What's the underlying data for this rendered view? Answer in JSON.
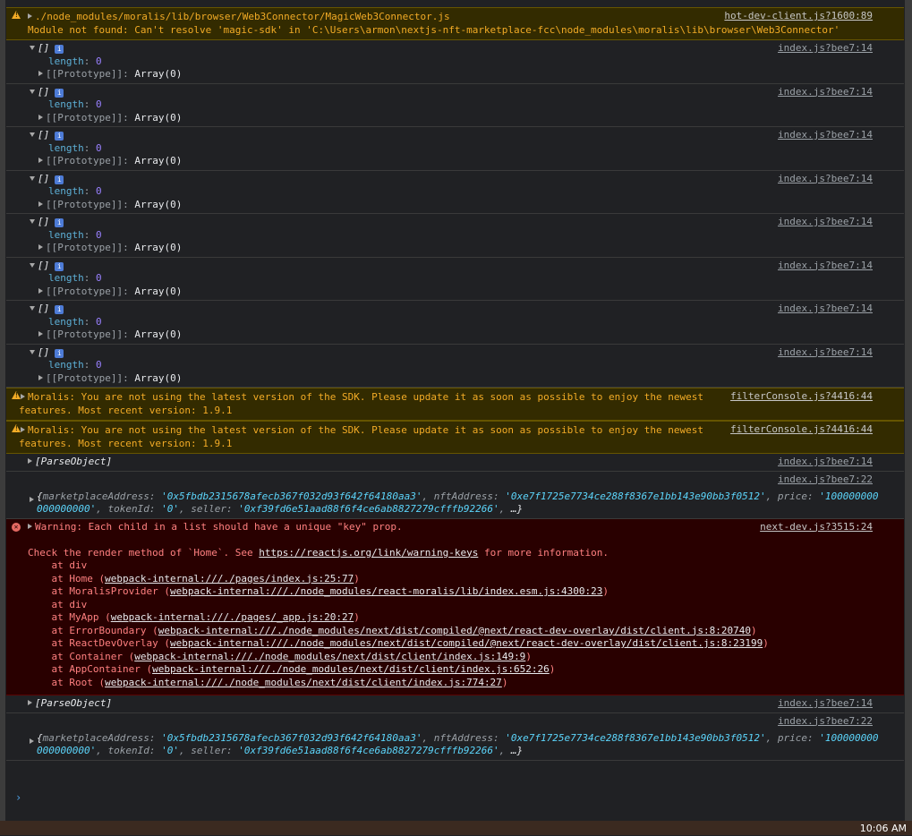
{
  "warning1": {
    "path": "./node_modules/moralis/lib/browser/Web3Connector/MagicWeb3Connector.js",
    "message": "Module not found: Can't resolve 'magic-sdk' in 'C:\\Users\\armon\\nextjs-nft-marketplace-fcc\\node_modules\\moralis\\lib\\browser\\Web3Connector'",
    "source": "hot-dev-client.js?1600:89"
  },
  "arrays": [
    {
      "label": "[]",
      "length_key": "length",
      "length_value": "0",
      "proto_key": "[[Prototype]]",
      "proto_value": "Array(0)",
      "source": "index.js?bee7:14"
    },
    {
      "label": "[]",
      "length_key": "length",
      "length_value": "0",
      "proto_key": "[[Prototype]]",
      "proto_value": "Array(0)",
      "source": "index.js?bee7:14"
    },
    {
      "label": "[]",
      "length_key": "length",
      "length_value": "0",
      "proto_key": "[[Prototype]]",
      "proto_value": "Array(0)",
      "source": "index.js?bee7:14"
    },
    {
      "label": "[]",
      "length_key": "length",
      "length_value": "0",
      "proto_key": "[[Prototype]]",
      "proto_value": "Array(0)",
      "source": "index.js?bee7:14"
    },
    {
      "label": "[]",
      "length_key": "length",
      "length_value": "0",
      "proto_key": "[[Prototype]]",
      "proto_value": "Array(0)",
      "source": "index.js?bee7:14"
    },
    {
      "label": "[]",
      "length_key": "length",
      "length_value": "0",
      "proto_key": "[[Prototype]]",
      "proto_value": "Array(0)",
      "source": "index.js?bee7:14"
    },
    {
      "label": "[]",
      "length_key": "length",
      "length_value": "0",
      "proto_key": "[[Prototype]]",
      "proto_value": "Array(0)",
      "source": "index.js?bee7:14"
    },
    {
      "label": "[]",
      "length_key": "length",
      "length_value": "0",
      "proto_key": "[[Prototype]]",
      "proto_value": "Array(0)",
      "source": "index.js?bee7:14"
    }
  ],
  "moralis_warnings": [
    {
      "line1": "Moralis: You are not using the latest version of the SDK. Please update it as soon as possible to enjoy the newest",
      "line2": "features. Most recent version: 1.9.1",
      "source": "filterConsole.js?4416:44"
    },
    {
      "line1": "Moralis: You are not using the latest version of the SDK. Please update it as soon as possible to enjoy the newest",
      "line2": "features. Most recent version: 1.9.1",
      "source": "filterConsole.js?4416:44"
    }
  ],
  "parse1": {
    "label": "[ParseObject]",
    "source": "index.js?bee7:14"
  },
  "obj1": {
    "source": "index.js?bee7:22",
    "k1": "marketplaceAddress",
    "v1": "'0x5fbdb2315678afecb367f032d93f642f64180aa3'",
    "k2": "nftAddress",
    "v2": "'0xe7f1725e7734ce288f8367e1bb143e90bb3f0512'",
    "k3": "price",
    "v3a": "'100000000",
    "v3b": "000000000'",
    "k4": "tokenId",
    "v4": "'0'",
    "k5": "seller",
    "v5": "'0xf39fd6e51aad88f6f4ce6ab8827279cfffb92266'",
    "tail": "…}"
  },
  "error": {
    "source": "next-dev.js?3515:24",
    "title": "Warning: Each child in a list should have a unique \"key\" prop.",
    "check_pre": "Check the render method of `Home`. See ",
    "check_link": "https://reactjs.org/link/warning-keys",
    "check_post": " for more information.",
    "stack": [
      {
        "pre": "    at div",
        "link": "",
        "post": ""
      },
      {
        "pre": "    at Home (",
        "link": "webpack-internal:///./pages/index.js:25:77",
        "post": ")"
      },
      {
        "pre": "    at MoralisProvider (",
        "link": "webpack-internal:///./node_modules/react-moralis/lib/index.esm.js:4300:23",
        "post": ")"
      },
      {
        "pre": "    at div",
        "link": "",
        "post": ""
      },
      {
        "pre": "    at MyApp (",
        "link": "webpack-internal:///./pages/_app.js:20:27",
        "post": ")"
      },
      {
        "pre": "    at ErrorBoundary (",
        "link": "webpack-internal:///./node_modules/next/dist/compiled/@next/react-dev-overlay/dist/client.js:8:20740",
        "post": ")"
      },
      {
        "pre": "    at ReactDevOverlay (",
        "link": "webpack-internal:///./node_modules/next/dist/compiled/@next/react-dev-overlay/dist/client.js:8:23199",
        "post": ")"
      },
      {
        "pre": "    at Container (",
        "link": "webpack-internal:///./node_modules/next/dist/client/index.js:149:9",
        "post": ")"
      },
      {
        "pre": "    at AppContainer (",
        "link": "webpack-internal:///./node_modules/next/dist/client/index.js:652:26",
        "post": ")"
      },
      {
        "pre": "    at Root (",
        "link": "webpack-internal:///./node_modules/next/dist/client/index.js:774:27",
        "post": ")"
      }
    ]
  },
  "parse2": {
    "label": "[ParseObject]",
    "source": "index.js?bee7:14"
  },
  "obj2": {
    "source": "index.js?bee7:22",
    "k1": "marketplaceAddress",
    "v1": "'0x5fbdb2315678afecb367f032d93f642f64180aa3'",
    "k2": "nftAddress",
    "v2": "'0xe7f1725e7734ce288f8367e1bb143e90bb3f0512'",
    "k3": "price",
    "v3a": "'100000000",
    "v3b": "000000000'",
    "k4": "tokenId",
    "v4": "'0'",
    "k5": "seller",
    "v5": "'0xf39fd6e51aad88f6f4ce6ab8827279cfffb92266'",
    "tail": "…}"
  },
  "prompt_symbol": "›",
  "clock": "10:06 AM",
  "colors": {
    "warning_bg": "#332b00",
    "warning_text": "#f2ab26",
    "error_bg": "#290000",
    "error_text": "#ff8080",
    "string": "#5cd5fb",
    "number": "#9980ff"
  }
}
